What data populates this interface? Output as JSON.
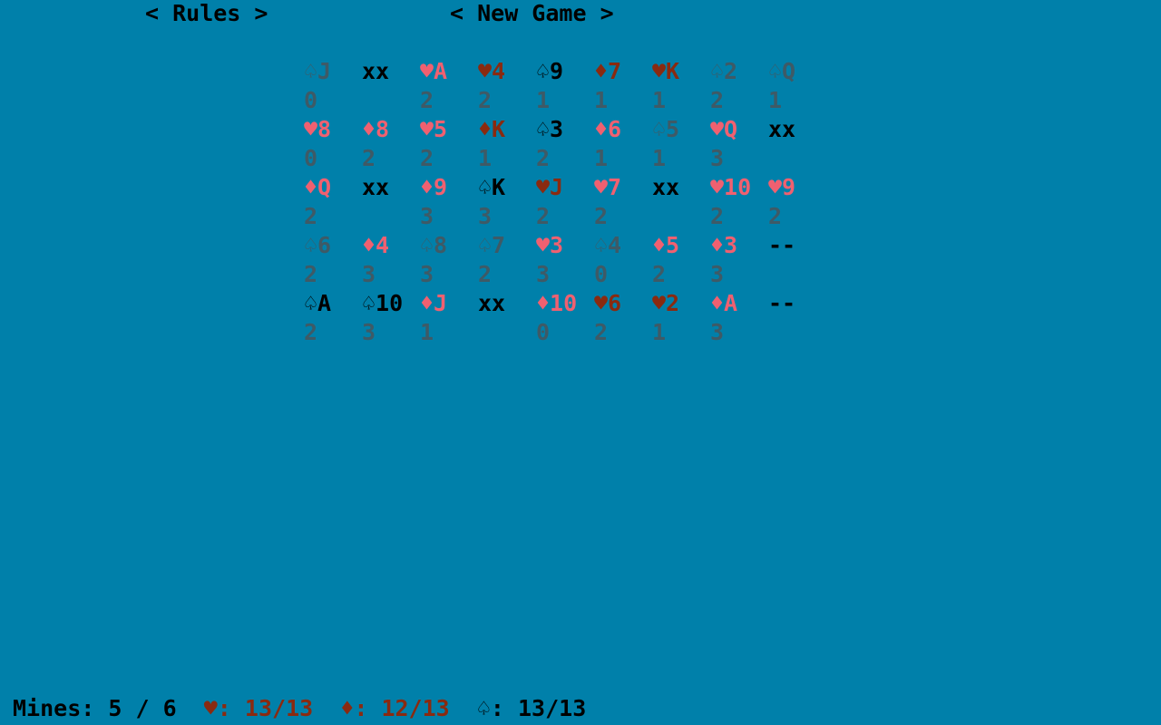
{
  "colors": {
    "background": "#0080aa",
    "black": "#000000",
    "pink": "#f06070",
    "brown": "#8a2a10",
    "gray": "#3e5a66"
  },
  "menu": {
    "rules_label": "< Rules >",
    "new_game_label": "< New Game >"
  },
  "board": [
    [
      {
        "card": "♤J",
        "num": "0",
        "color": "gray"
      },
      {
        "card": "xx",
        "num": "",
        "color": "black"
      },
      {
        "card": "♥A",
        "num": "2",
        "color": "pink"
      },
      {
        "card": "♥4",
        "num": "2",
        "color": "brown"
      },
      {
        "card": "♤9",
        "num": "1",
        "color": "black"
      },
      {
        "card": "♦7",
        "num": "1",
        "color": "brown"
      },
      {
        "card": "♥K",
        "num": "1",
        "color": "brown"
      },
      {
        "card": "♤2",
        "num": "2",
        "color": "gray"
      },
      {
        "card": "♤Q",
        "num": "1",
        "color": "gray"
      }
    ],
    [
      {
        "card": "♥8",
        "num": "0",
        "color": "pink"
      },
      {
        "card": "♦8",
        "num": "2",
        "color": "pink"
      },
      {
        "card": "♥5",
        "num": "2",
        "color": "pink"
      },
      {
        "card": "♦K",
        "num": "1",
        "color": "brown"
      },
      {
        "card": "♤3",
        "num": "2",
        "color": "black"
      },
      {
        "card": "♦6",
        "num": "1",
        "color": "pink"
      },
      {
        "card": "♤5",
        "num": "1",
        "color": "gray"
      },
      {
        "card": "♥Q",
        "num": "3",
        "color": "pink"
      },
      {
        "card": "xx",
        "num": "",
        "color": "black"
      }
    ],
    [
      {
        "card": "♦Q",
        "num": "2",
        "color": "pink"
      },
      {
        "card": "xx",
        "num": "",
        "color": "black"
      },
      {
        "card": "♦9",
        "num": "3",
        "color": "pink"
      },
      {
        "card": "♤K",
        "num": "3",
        "color": "black"
      },
      {
        "card": "♥J",
        "num": "2",
        "color": "brown"
      },
      {
        "card": "♥7",
        "num": "2",
        "color": "pink"
      },
      {
        "card": "xx",
        "num": "",
        "color": "black"
      },
      {
        "card": "♥10",
        "num": "2",
        "color": "pink"
      },
      {
        "card": "♥9",
        "num": "2",
        "color": "pink"
      }
    ],
    [
      {
        "card": "♤6",
        "num": "2",
        "color": "gray"
      },
      {
        "card": "♦4",
        "num": "3",
        "color": "pink"
      },
      {
        "card": "♤8",
        "num": "3",
        "color": "gray"
      },
      {
        "card": "♤7",
        "num": "2",
        "color": "gray"
      },
      {
        "card": "♥3",
        "num": "3",
        "color": "pink"
      },
      {
        "card": "♤4",
        "num": "0",
        "color": "gray"
      },
      {
        "card": "♦5",
        "num": "2",
        "color": "pink"
      },
      {
        "card": "♦3",
        "num": "3",
        "color": "pink"
      },
      {
        "card": "--",
        "num": "",
        "color": "black"
      }
    ],
    [
      {
        "card": "♤A",
        "num": "2",
        "color": "black"
      },
      {
        "card": "♤10",
        "num": "3",
        "color": "black"
      },
      {
        "card": "♦J",
        "num": "1",
        "color": "pink"
      },
      {
        "card": "xx",
        "num": "",
        "color": "black"
      },
      {
        "card": "♦10",
        "num": "0",
        "color": "pink"
      },
      {
        "card": "♥6",
        "num": "2",
        "color": "brown"
      },
      {
        "card": "♥2",
        "num": "1",
        "color": "brown"
      },
      {
        "card": "♦A",
        "num": "3",
        "color": "pink"
      },
      {
        "card": "--",
        "num": "",
        "color": "black"
      }
    ]
  ],
  "status": {
    "mines_label": "Mines: 5 / 6",
    "hearts_symbol": "♥",
    "hearts_count": ": 13/13",
    "diamonds_symbol": "♦",
    "diamonds_count": ": 12/13",
    "spades_symbol": "♤",
    "spades_count": ": 13/13"
  }
}
